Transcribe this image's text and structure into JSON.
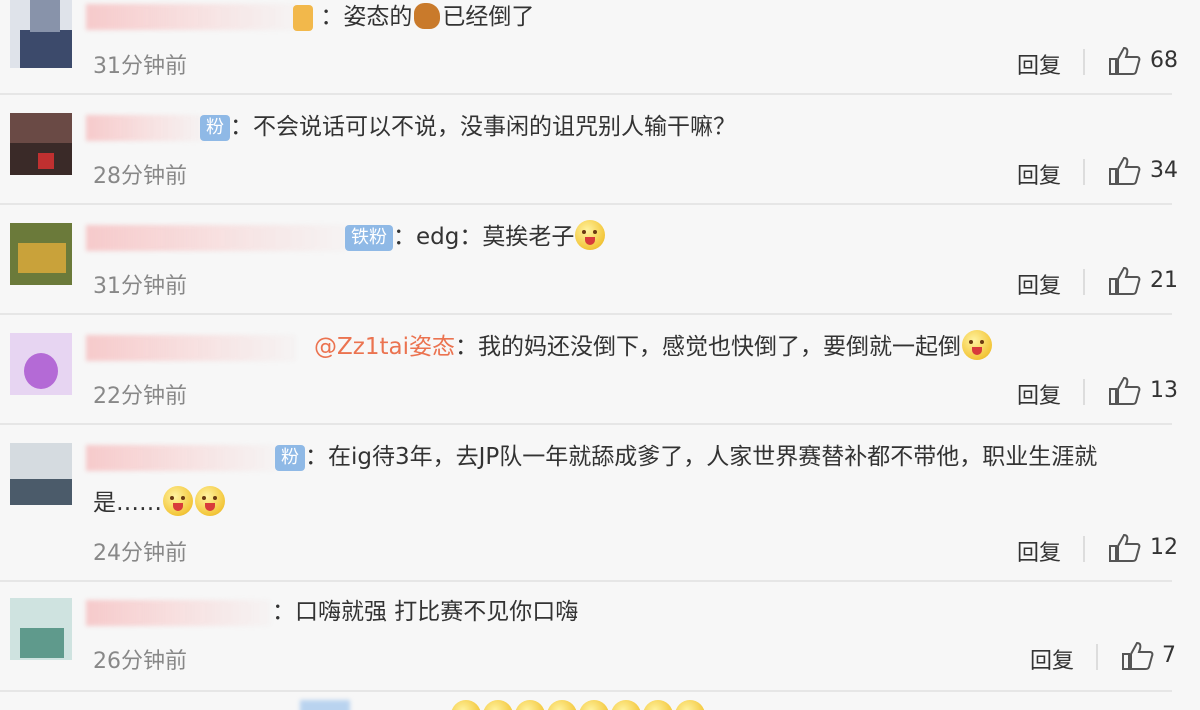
{
  "comments": [
    {
      "time": "31分钟前",
      "badge": "",
      "mention": "",
      "text": "：姿态的",
      "text2": "已经倒了",
      "likes": "68",
      "reply": "回复"
    },
    {
      "time": "28分钟前",
      "badge": "粉",
      "mention": "",
      "text": "：不会说话可以不说，没事闲的诅咒别人输干嘛？",
      "likes": "34",
      "reply": "回复"
    },
    {
      "time": "31分钟前",
      "badge": "铁粉",
      "mention": "",
      "text": "：edg：莫挨老子",
      "likes": "21",
      "reply": "回复"
    },
    {
      "time": "22分钟前",
      "badge": "",
      "mention": "@Zz1tai姿态",
      "text": "：我的妈还没倒下，感觉也快倒了，要倒就一起倒",
      "likes": "13",
      "reply": "回复"
    },
    {
      "time": "24分钟前",
      "badge": "粉",
      "mention": "",
      "text": "：在ig待3年，去JP队一年就舔成爹了，人家世界赛替补都不带他，职业生涯就",
      "text2": "是……",
      "likes": "12",
      "reply": "回复"
    },
    {
      "time": "26分钟前",
      "badge": "",
      "mention": "",
      "text": "：口嗨就强 打比赛不见你口嗨",
      "likes": "7",
      "reply": "回复"
    }
  ],
  "icons": {
    "like": "thumbs-up-icon",
    "emoji": "laughing-face-icon"
  }
}
